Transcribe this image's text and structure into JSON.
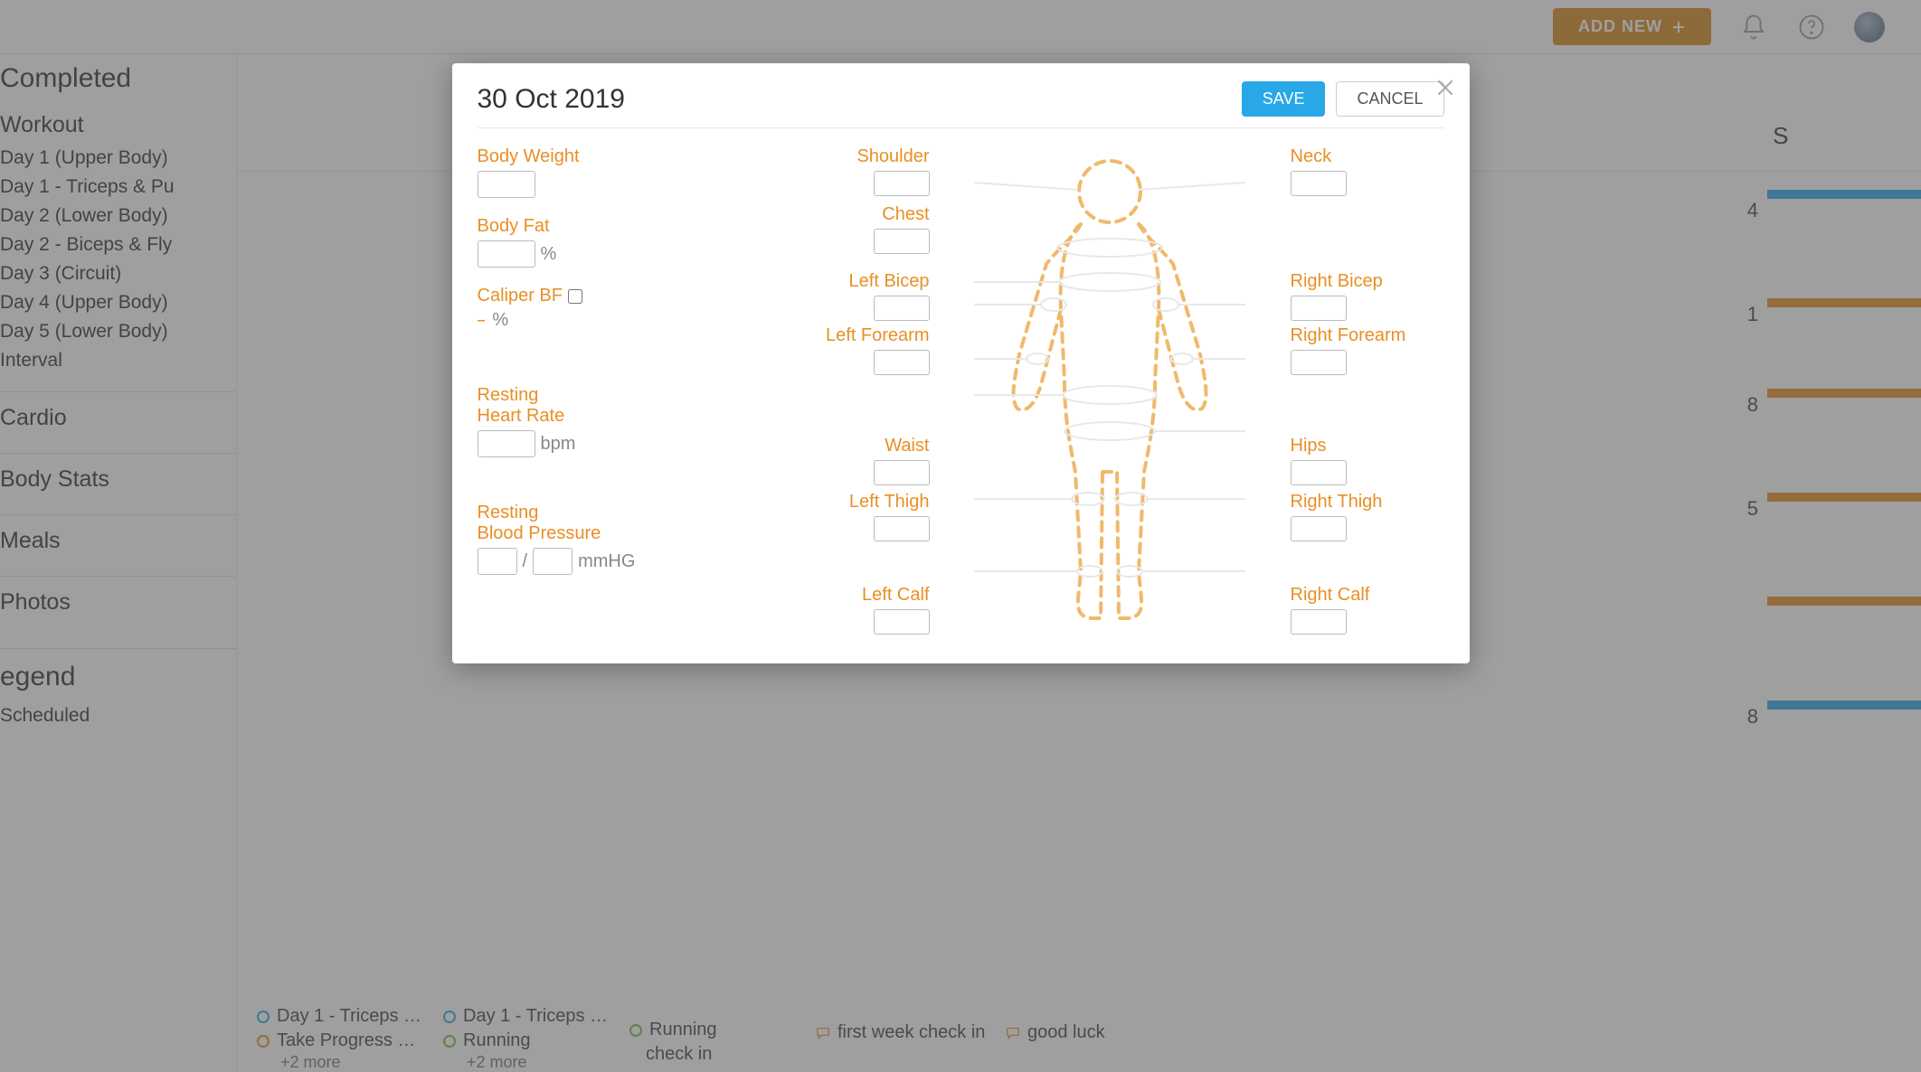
{
  "topbar": {
    "add_new": "ADD NEW"
  },
  "sidebar": {
    "completed": "Completed",
    "workout_label": "Workout",
    "workouts": [
      "Day 1 (Upper Body)",
      "Day 1 - Triceps & Pu",
      "Day 2 (Lower Body)",
      "Day 2 - Biceps & Fly",
      "Day 3 (Circuit)",
      "Day 4 (Upper Body)",
      "Day 5 (Lower Body)",
      "Interval"
    ],
    "cardio": "Cardio",
    "body_stats": "Body Stats",
    "meals": "Meals",
    "photos": "Photos",
    "legend": "egend",
    "scheduled": "Scheduled"
  },
  "calendar": {
    "day_header": "S",
    "visible_numbers": [
      "4",
      "1",
      "8",
      "5",
      "8"
    ],
    "cols": [
      {
        "events": [
          "Day 1 - Triceps …",
          "Take Progress …"
        ],
        "more": "+2 more"
      },
      {
        "events": [
          "Day 1 - Triceps …",
          "Running"
        ],
        "more": "+2 more"
      },
      {
        "events_plain": [
          "Running",
          "check in"
        ]
      },
      {
        "msg": "first week check in"
      },
      {
        "msg": "good luck"
      }
    ]
  },
  "modal": {
    "title": "30 Oct 2019",
    "save": "SAVE",
    "cancel": "CANCEL",
    "fields": {
      "body_weight": "Body Weight",
      "body_fat": "Body Fat",
      "body_fat_unit": "%",
      "caliper": "Caliper BF",
      "caliper_unit": "%",
      "resting_hr_l1": "Resting",
      "resting_hr_l2": "Heart Rate",
      "resting_hr_unit": "bpm",
      "resting_bp_l1": "Resting",
      "resting_bp_l2": "Blood Pressure",
      "resting_bp_unit": "mmHG"
    },
    "measurements": {
      "shoulder": "Shoulder",
      "chest": "Chest",
      "left_bicep": "Left Bicep",
      "left_forearm": "Left Forearm",
      "waist": "Waist",
      "left_thigh": "Left Thigh",
      "left_calf": "Left Calf",
      "neck": "Neck",
      "right_bicep": "Right Bicep",
      "right_forearm": "Right Forearm",
      "hips": "Hips",
      "right_thigh": "Right Thigh",
      "right_calf": "Right Calf"
    }
  }
}
